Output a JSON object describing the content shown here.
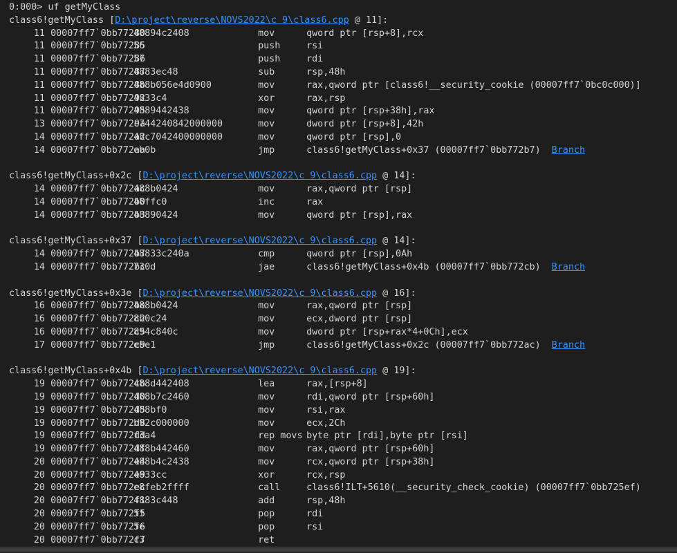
{
  "prompt": "0:000> uf getMyClass",
  "theme": {
    "background": "#1e1e1e",
    "text": "#d4d4d4",
    "link": "#3794ff"
  },
  "blocks": [
    {
      "label": "class6!getMyClass",
      "source": "D:\\project\\reverse\\NOVS2022\\c 9\\class6.cpp",
      "at": "@ 11]:",
      "rows": [
        {
          "ln": "11",
          "addr": "00007ff7`0bb77280",
          "bytes": "48894c2408",
          "mn": "mov",
          "ops": "qword ptr [rsp+8],rcx"
        },
        {
          "ln": "11",
          "addr": "00007ff7`0bb77285",
          "bytes": "56",
          "mn": "push",
          "ops": "rsi"
        },
        {
          "ln": "11",
          "addr": "00007ff7`0bb77286",
          "bytes": "57",
          "mn": "push",
          "ops": "rdi"
        },
        {
          "ln": "11",
          "addr": "00007ff7`0bb77287",
          "bytes": "4883ec48",
          "mn": "sub",
          "ops": "rsp,48h"
        },
        {
          "ln": "11",
          "addr": "00007ff7`0bb7728b",
          "bytes": "488b056e4d0900",
          "mn": "mov",
          "ops": "rax,qword ptr [class6!__security_cookie (00007ff7`0bc0c000)]"
        },
        {
          "ln": "11",
          "addr": "00007ff7`0bb77292",
          "bytes": "4833c4",
          "mn": "xor",
          "ops": "rax,rsp"
        },
        {
          "ln": "11",
          "addr": "00007ff7`0bb77295",
          "bytes": "4889442438",
          "mn": "mov",
          "ops": "qword ptr [rsp+38h],rax"
        },
        {
          "ln": "13",
          "addr": "00007ff7`0bb7729a",
          "bytes": "c744240842000000",
          "mn": "mov",
          "ops": "dword ptr [rsp+8],42h"
        },
        {
          "ln": "14",
          "addr": "00007ff7`0bb772a2",
          "bytes": "48c7042400000000",
          "mn": "mov",
          "ops": "qword ptr [rsp],0"
        },
        {
          "ln": "14",
          "addr": "00007ff7`0bb772aa",
          "bytes": "eb0b",
          "mn": "jmp",
          "ops": "class6!getMyClass+0x37 (00007ff7`0bb772b7)",
          "branch": "Branch"
        }
      ]
    },
    {
      "label": "class6!getMyClass+0x2c",
      "source": "D:\\project\\reverse\\NOVS2022\\c 9\\class6.cpp",
      "at": "@ 14]:",
      "rows": [
        {
          "ln": "14",
          "addr": "00007ff7`0bb772ac",
          "bytes": "488b0424",
          "mn": "mov",
          "ops": "rax,qword ptr [rsp]"
        },
        {
          "ln": "14",
          "addr": "00007ff7`0bb772b0",
          "bytes": "48ffc0",
          "mn": "inc",
          "ops": "rax"
        },
        {
          "ln": "14",
          "addr": "00007ff7`0bb772b3",
          "bytes": "48890424",
          "mn": "mov",
          "ops": "qword ptr [rsp],rax"
        }
      ]
    },
    {
      "label": "class6!getMyClass+0x37",
      "source": "D:\\project\\reverse\\NOVS2022\\c 9\\class6.cpp",
      "at": "@ 14]:",
      "rows": [
        {
          "ln": "14",
          "addr": "00007ff7`0bb772b7",
          "bytes": "48833c240a",
          "mn": "cmp",
          "ops": "qword ptr [rsp],0Ah"
        },
        {
          "ln": "14",
          "addr": "00007ff7`0bb772bc",
          "bytes": "730d",
          "mn": "jae",
          "ops": "class6!getMyClass+0x4b (00007ff7`0bb772cb)",
          "branch": "Branch"
        }
      ]
    },
    {
      "label": "class6!getMyClass+0x3e",
      "source": "D:\\project\\reverse\\NOVS2022\\c 9\\class6.cpp",
      "at": "@ 16]:",
      "rows": [
        {
          "ln": "16",
          "addr": "00007ff7`0bb772be",
          "bytes": "488b0424",
          "mn": "mov",
          "ops": "rax,qword ptr [rsp]"
        },
        {
          "ln": "16",
          "addr": "00007ff7`0bb772c2",
          "bytes": "8b0c24",
          "mn": "mov",
          "ops": "ecx,dword ptr [rsp]"
        },
        {
          "ln": "16",
          "addr": "00007ff7`0bb772c5",
          "bytes": "894c840c",
          "mn": "mov",
          "ops": "dword ptr [rsp+rax*4+0Ch],ecx"
        },
        {
          "ln": "17",
          "addr": "00007ff7`0bb772c9",
          "bytes": "ebe1",
          "mn": "jmp",
          "ops": "class6!getMyClass+0x2c (00007ff7`0bb772ac)",
          "branch": "Branch"
        }
      ]
    },
    {
      "label": "class6!getMyClass+0x4b",
      "source": "D:\\project\\reverse\\NOVS2022\\c 9\\class6.cpp",
      "at": "@ 19]:",
      "rows": [
        {
          "ln": "19",
          "addr": "00007ff7`0bb772cb",
          "bytes": "488d442408",
          "mn": "lea",
          "ops": "rax,[rsp+8]"
        },
        {
          "ln": "19",
          "addr": "00007ff7`0bb772d0",
          "bytes": "488b7c2460",
          "mn": "mov",
          "ops": "rdi,qword ptr [rsp+60h]"
        },
        {
          "ln": "19",
          "addr": "00007ff7`0bb772d5",
          "bytes": "488bf0",
          "mn": "mov",
          "ops": "rsi,rax"
        },
        {
          "ln": "19",
          "addr": "00007ff7`0bb772d8",
          "bytes": "b92c000000",
          "mn": "mov",
          "ops": "ecx,2Ch"
        },
        {
          "ln": "19",
          "addr": "00007ff7`0bb772dd",
          "bytes": "f3a4",
          "mn": "rep movs",
          "ops": "byte ptr [rdi],byte ptr [rsi]"
        },
        {
          "ln": "19",
          "addr": "00007ff7`0bb772df",
          "bytes": "488b442460",
          "mn": "mov",
          "ops": "rax,qword ptr [rsp+60h]"
        },
        {
          "ln": "20",
          "addr": "00007ff7`0bb772e4",
          "bytes": "488b4c2438",
          "mn": "mov",
          "ops": "rcx,qword ptr [rsp+38h]"
        },
        {
          "ln": "20",
          "addr": "00007ff7`0bb772e9",
          "bytes": "4833cc",
          "mn": "xor",
          "ops": "rcx,rsp"
        },
        {
          "ln": "20",
          "addr": "00007ff7`0bb772ec",
          "bytes": "e8feb2ffff",
          "mn": "call",
          "ops": "class6!ILT+5610(__security_check_cookie) (00007ff7`0bb725ef)"
        },
        {
          "ln": "20",
          "addr": "00007ff7`0bb772f1",
          "bytes": "4883c448",
          "mn": "add",
          "ops": "rsp,48h"
        },
        {
          "ln": "20",
          "addr": "00007ff7`0bb772f5",
          "bytes": "5f",
          "mn": "pop",
          "ops": "rdi"
        },
        {
          "ln": "20",
          "addr": "00007ff7`0bb772f6",
          "bytes": "5e",
          "mn": "pop",
          "ops": "rsi"
        },
        {
          "ln": "20",
          "addr": "00007ff7`0bb772f7",
          "bytes": "c3",
          "mn": "ret",
          "ops": ""
        }
      ]
    }
  ]
}
